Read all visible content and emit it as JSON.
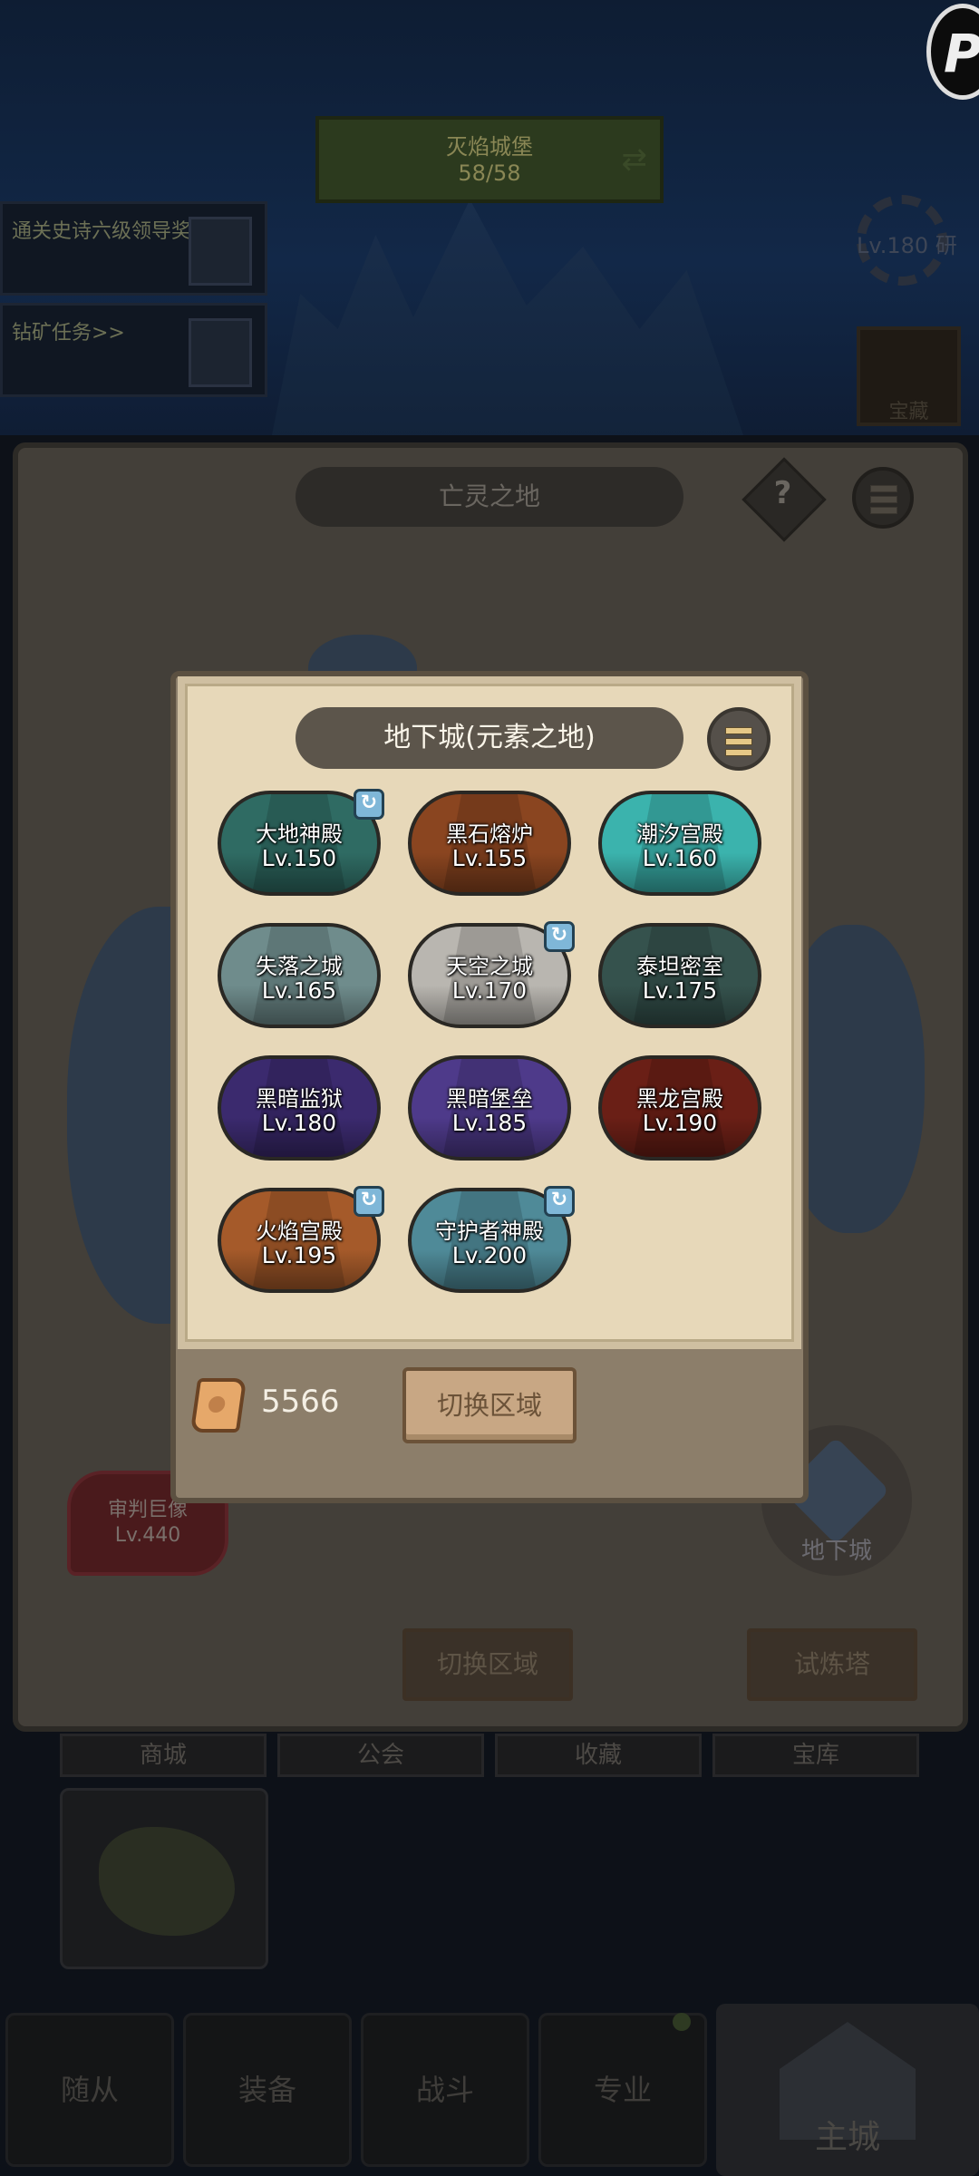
{
  "background": {
    "top_banner": {
      "line1": "灭焰城堡",
      "line2": "58/58"
    },
    "side_cards": [
      {
        "text": "通关史诗六级领导奖"
      },
      {
        "text": "钻矿任务>>"
      }
    ],
    "top_right_badge": "P",
    "gear_widget": "Lv.180 研",
    "book_widget": "宝藏",
    "outer_panel": {
      "title": "亡灵之地",
      "help": "?"
    },
    "judge_card": {
      "name": "审判巨像",
      "level": "Lv.440"
    },
    "dungeon_widget": "地下城",
    "buttons": {
      "switch_region": "切换区域",
      "trial_tower": "试炼塔"
    },
    "tabs": [
      "商城",
      "公会",
      "收藏",
      "宝库"
    ],
    "bottom_nav": [
      "随从",
      "装备",
      "战斗",
      "专业"
    ],
    "main_nav": "主城"
  },
  "modal": {
    "title": "地下城(元素之地)",
    "dungeons": [
      {
        "name": "大地神殿",
        "level": "Lv.150",
        "swirl": true,
        "color": "#2f6b63"
      },
      {
        "name": "黑石熔炉",
        "level": "Lv.155",
        "swirl": false,
        "color": "#8a4520"
      },
      {
        "name": "潮汐宫殿",
        "level": "Lv.160",
        "swirl": false,
        "color": "#3bb3ad"
      },
      {
        "name": "失落之城",
        "level": "Lv.165",
        "swirl": false,
        "color": "#6f8c8c"
      },
      {
        "name": "天空之城",
        "level": "Lv.170",
        "swirl": true,
        "color": "#b9b6b0"
      },
      {
        "name": "泰坦密室",
        "level": "Lv.175",
        "swirl": false,
        "color": "#35524d"
      },
      {
        "name": "黑暗监狱",
        "level": "Lv.180",
        "swirl": false,
        "color": "#3b2a6e"
      },
      {
        "name": "黑暗堡垒",
        "level": "Lv.185",
        "swirl": false,
        "color": "#4e3a8a"
      },
      {
        "name": "黑龙宫殿",
        "level": "Lv.190",
        "swirl": false,
        "color": "#6a1f16"
      },
      {
        "name": "火焰宫殿",
        "level": "Lv.195",
        "swirl": true,
        "color": "#a55a2a"
      },
      {
        "name": "守护者神殿",
        "level": "Lv.200",
        "swirl": true,
        "color": "#4f8a98"
      }
    ],
    "currency": {
      "icon": "scroll-icon",
      "value": "5566"
    },
    "switch_button": "切换区域"
  }
}
